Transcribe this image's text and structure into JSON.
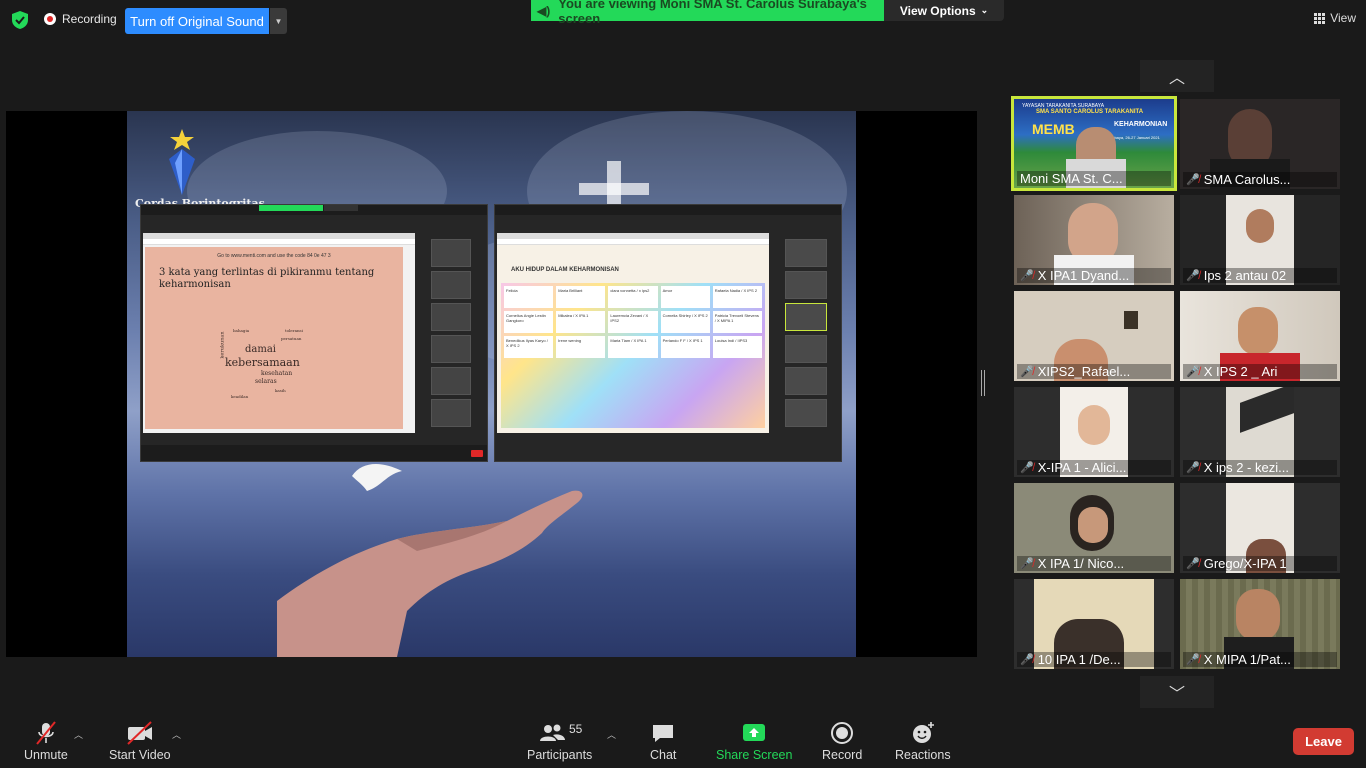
{
  "topbar": {
    "recording_label": "Recording",
    "original_sound_button": "Turn off Original Sound",
    "share_banner": "You are viewing Moni SMA St. Carolus Surabaya's screen",
    "view_options": "View Options",
    "view_label": "View",
    "colors": {
      "security": "#23d959",
      "banner": "#23d959",
      "primary_button": "#2d8cff"
    }
  },
  "shared_screen": {
    "slide_logo_text": "Cordas Borintogritas",
    "menti_prompt": "3 kata yang terlintas di pikiranmu tentang keharmonisan",
    "menti_top": "Go to www.menti.com and use the code 84 0e 47 3",
    "wordcloud": {
      "words": [
        "damai",
        "kebersamaan",
        "kesehatan",
        "selaras",
        "kerukunan",
        "toleransi",
        "persatuan",
        "bahagia",
        "kasih",
        "keadilan"
      ]
    },
    "padlet_title": "AKU HIDUP DALAM KEHARMONISAN",
    "padlet_cards": [
      [
        "Felicia",
        "Cornelius Angie Lestin Gangkoro",
        "Benedikus Ilyas Karyo / X IPS 2"
      ],
      [
        "Maria Brilliant",
        "Mikalea / X IPA 1",
        "Irene wening"
      ],
      [
        "clara vonnetta / x ips2",
        "Lauremcia Zevani / X IPS2",
        "Maria Tiam / X IPA 1"
      ],
      [
        "Amor",
        "Cornelia Shirley / X IPS 2",
        "Perlando F F / X IPS 1"
      ],
      [
        "Rafaela Nadia / X IPS 2",
        "Patricia Trevoeli Stevens / X MIPA 1",
        "Louisa Indi / IIPS3"
      ]
    ]
  },
  "gallery": {
    "participants": [
      {
        "name": "Moni SMA St. C...",
        "muted": false,
        "active": true
      },
      {
        "name": "SMA Carolus...",
        "muted": true
      },
      {
        "name": "X IPA1 Dyand...",
        "muted": true
      },
      {
        "name": "Ips 2 antau 02",
        "muted": true
      },
      {
        "name": "XIPS2_Rafael...",
        "muted": true
      },
      {
        "name": "X IPS 2 _ Ari",
        "muted": true
      },
      {
        "name": "X-IPA 1 - Alici...",
        "muted": true
      },
      {
        "name": "X ips 2 - kezi...",
        "muted": true
      },
      {
        "name": "X IPA 1/ Nico...",
        "muted": true
      },
      {
        "name": "Grego/X-IPA 1",
        "muted": true
      },
      {
        "name": "10 IPA 1 /De...",
        "muted": true
      },
      {
        "name": "X MIPA 1/Pat...",
        "muted": true
      }
    ],
    "moni_tile_text": [
      "YAYASAN TARAKANITA SURABAYA",
      "SMA SANTO CAROLUS TARAKANITA",
      "MEMB",
      "KEHARMONIAN",
      "Surabaya, 26-27 Januari 2021"
    ]
  },
  "toolbar": {
    "unmute": "Unmute",
    "start_video": "Start Video",
    "participants": "Participants",
    "participants_count": "55",
    "chat": "Chat",
    "share_screen": "Share Screen",
    "record": "Record",
    "reactions": "Reactions",
    "leave": "Leave",
    "colors": {
      "share": "#23d959",
      "leave": "#d23b32",
      "muted": "#e02828"
    }
  }
}
